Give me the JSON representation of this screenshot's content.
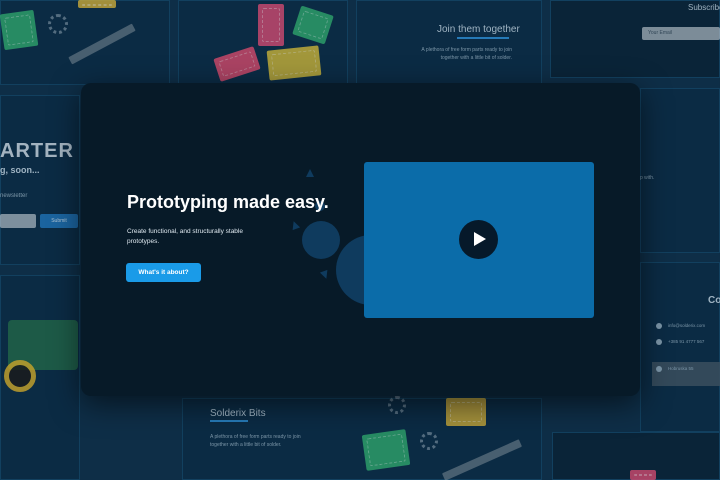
{
  "background": {
    "join_title": "Join them together",
    "join_text": "A plethora of free form parts ready to join together with a little bit of solder.",
    "subscribe_label": "Subscribe",
    "email_placeholder": "Your Email",
    "coming_soon_big": "ARTER",
    "coming_soon_small": "g, soon...",
    "newsletter_label": "newsletter",
    "submit_label": "Submit",
    "right_snippet": "p with.",
    "contact_heading": "Co",
    "contact_email": "info@solderix.com",
    "contact_phone": "+385 91 4777 567",
    "contact_address": "Hobruska 55",
    "bits_title": "Solderix Bits",
    "bits_text": "A plethora of free form parts ready to join together with a little bit of solder."
  },
  "modal": {
    "title": "Prototyping made easy.",
    "subtitle": "Create functional, and structurally stable prototypes.",
    "cta_label": "What's it about?",
    "play_icon": "play-icon"
  },
  "colors": {
    "modal_bg": "#071a28",
    "accent": "#1a9be8",
    "video_panel": "#0b6ca9",
    "page_bg": "#0e2e47"
  }
}
